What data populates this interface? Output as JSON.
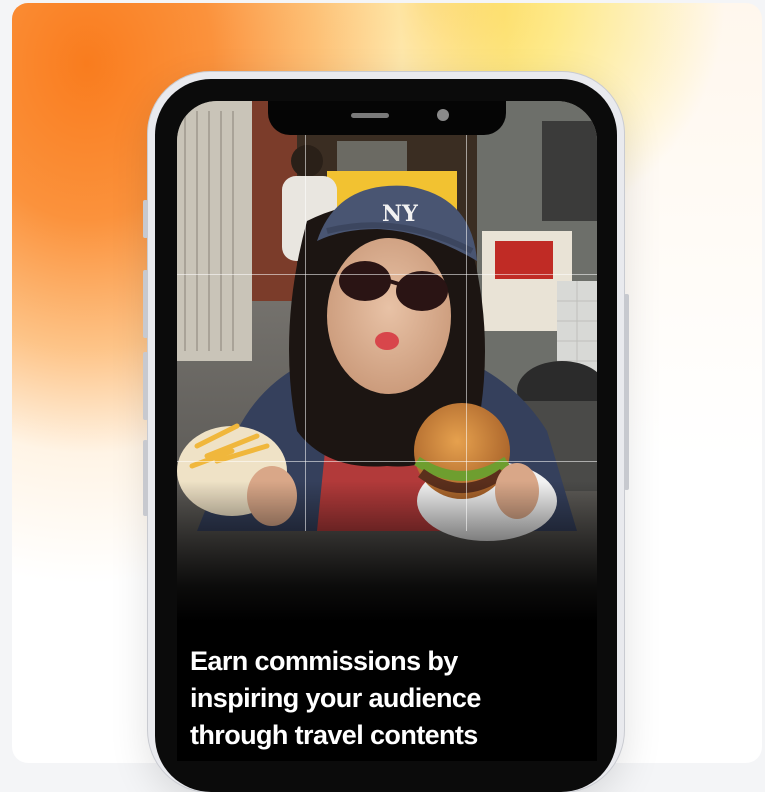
{
  "hero": {
    "headline_lines": [
      "Earn commissions by",
      "inspiring your audience",
      "through travel contents"
    ]
  },
  "photo": {
    "description_icon": "creator-selfie-photo",
    "grid": "rule-of-thirds"
  },
  "colors": {
    "accent_orange": "#f97c1e",
    "accent_yellow": "#fcd34d",
    "phone_frame": "#e9eaee",
    "screen_bg": "#000000",
    "headline_text": "#ffffff"
  }
}
